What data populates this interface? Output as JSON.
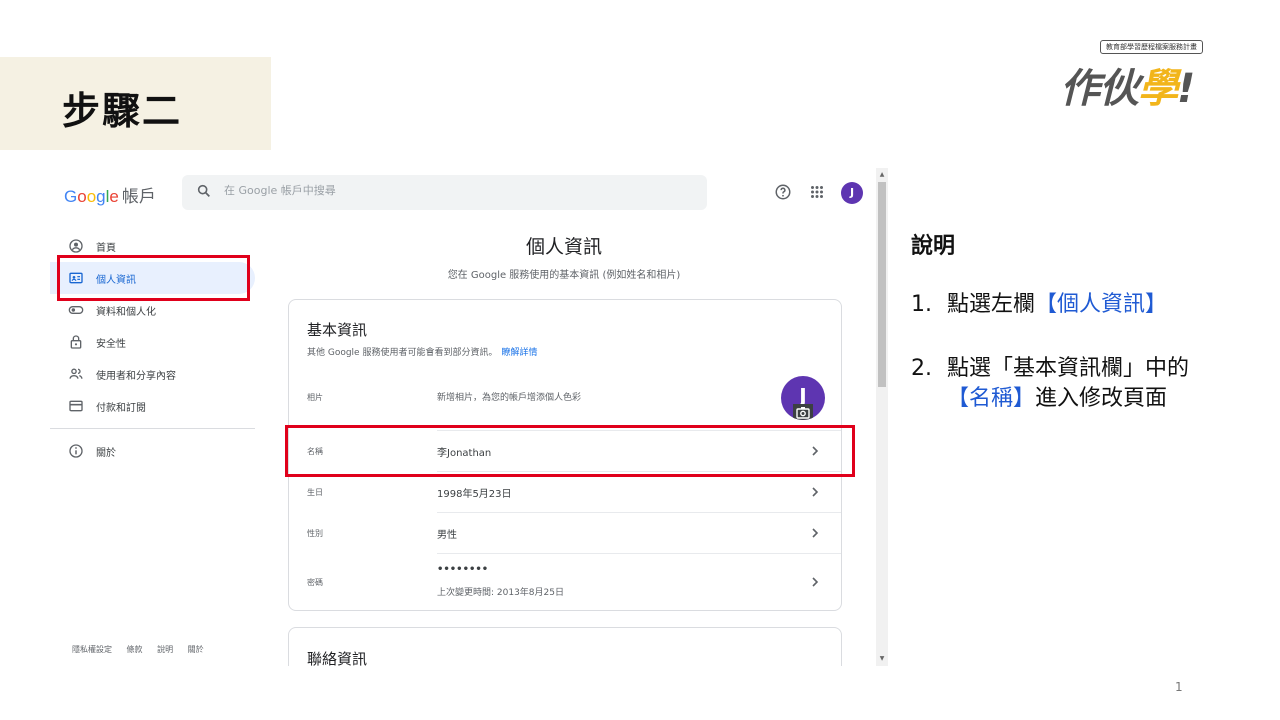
{
  "slide": {
    "step_title": "步驟二",
    "page_number": "1"
  },
  "logo": {
    "tagline": "教育部學習歷程檔案服務計畫",
    "text_main": "作伙",
    "text_accent": "學",
    "text_end": "!"
  },
  "header": {
    "logo_letters": [
      "G",
      "o",
      "o",
      "g",
      "l",
      "e"
    ],
    "product": "帳戶",
    "search_placeholder": "在 Google 帳戶中搜尋",
    "avatar_initial": "J"
  },
  "sidebar": {
    "items": [
      {
        "label": "首頁",
        "icon": "home-icon"
      },
      {
        "label": "個人資訊",
        "icon": "id-card-icon"
      },
      {
        "label": "資料和個人化",
        "icon": "toggle-icon"
      },
      {
        "label": "安全性",
        "icon": "lock-icon"
      },
      {
        "label": "使用者和分享內容",
        "icon": "people-icon"
      },
      {
        "label": "付款和訂閱",
        "icon": "credit-card-icon"
      }
    ],
    "about": {
      "label": "關於",
      "icon": "info-icon"
    },
    "footer": [
      "隱私權設定",
      "條款",
      "說明",
      "關於"
    ]
  },
  "main": {
    "title": "個人資訊",
    "subtitle": "您在 Google 服務使用的基本資訊 (例如姓名和相片)",
    "basic_info": {
      "title": "基本資訊",
      "subtitle": "其他 Google 服務使用者可能會看到部分資訊。",
      "learn_more": "瞭解詳情",
      "photo": {
        "label": "相片",
        "value": "新增相片，為您的帳戶增添個人色彩",
        "avatar_initial": "J"
      },
      "name": {
        "label": "名稱",
        "value": "李Jonathan"
      },
      "birthday": {
        "label": "生日",
        "value": "1998年5月23日"
      },
      "gender": {
        "label": "性別",
        "value": "男性"
      },
      "password": {
        "label": "密碼",
        "value": "••••••••",
        "note": "上次變更時間: 2013年8月25日"
      }
    },
    "contact_info": {
      "title": "聯絡資訊"
    }
  },
  "explanation": {
    "title": "說明",
    "item1": {
      "num": "1.",
      "text": "點選左欄",
      "highlight": "【個人資訊】"
    },
    "item2": {
      "num": "2.",
      "text": "點選「基本資訊欄」中的",
      "highlight": "【名稱】",
      "text_end": "進入修改頁面"
    }
  },
  "colors": {
    "highlight_red": "#e0001b",
    "link_blue": "#1a73e8",
    "avatar_purple": "#5e35b1",
    "step_bg": "#f5f1e3"
  }
}
